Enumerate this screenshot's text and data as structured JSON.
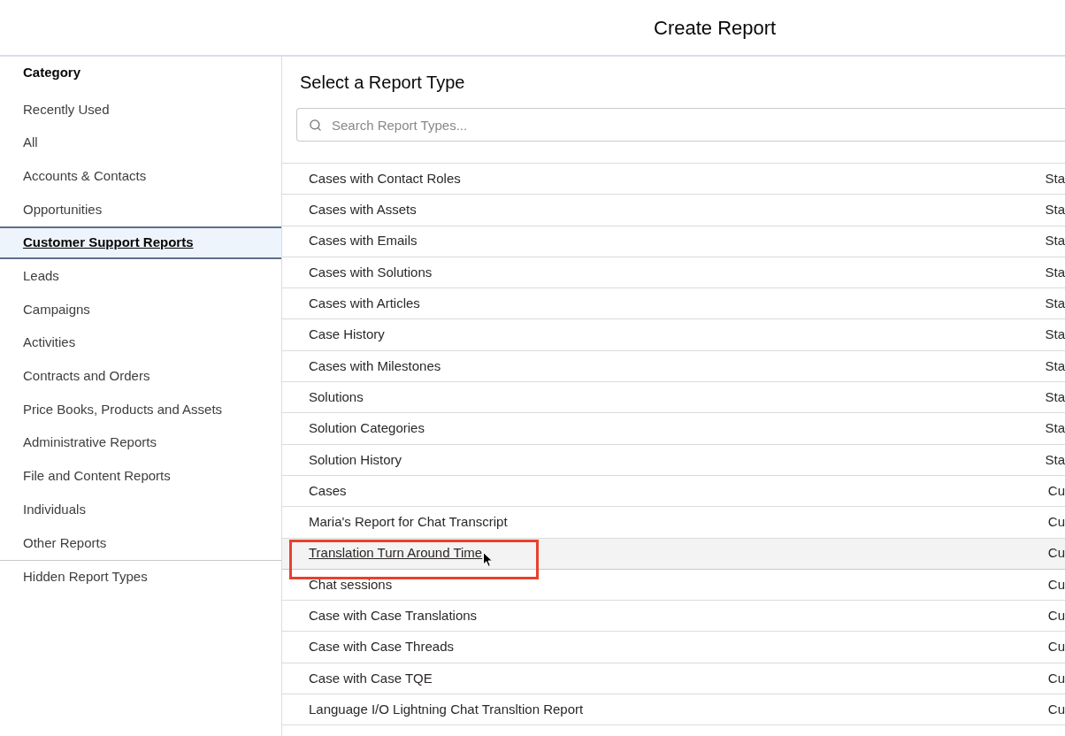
{
  "dialog": {
    "title": "Create Report"
  },
  "sidebar": {
    "heading": "Category",
    "items": [
      {
        "label": "Recently Used",
        "selected": false
      },
      {
        "label": "All",
        "selected": false
      },
      {
        "label": "Accounts & Contacts",
        "selected": false
      },
      {
        "label": "Opportunities",
        "selected": false
      },
      {
        "label": "Customer Support Reports",
        "selected": true
      },
      {
        "label": "Leads",
        "selected": false
      },
      {
        "label": "Campaigns",
        "selected": false
      },
      {
        "label": "Activities",
        "selected": false
      },
      {
        "label": "Contracts and Orders",
        "selected": false
      },
      {
        "label": "Price Books, Products and Assets",
        "selected": false
      },
      {
        "label": "Administrative Reports",
        "selected": false
      },
      {
        "label": "File and Content Reports",
        "selected": false
      },
      {
        "label": "Individuals",
        "selected": false
      },
      {
        "label": "Other Reports",
        "selected": false
      }
    ],
    "footer_items": [
      {
        "label": "Hidden Report Types",
        "selected": false
      }
    ]
  },
  "report_types": {
    "title": "Select a Report Type",
    "search": {
      "placeholder": "Search Report Types..."
    },
    "rows": [
      {
        "name": "Cases with Contact Roles",
        "column_2": "Sta",
        "hovered": false,
        "annotated": false
      },
      {
        "name": "Cases with Assets",
        "column_2": "Sta",
        "hovered": false,
        "annotated": false
      },
      {
        "name": "Cases with Emails",
        "column_2": "Sta",
        "hovered": false,
        "annotated": false
      },
      {
        "name": "Cases with Solutions",
        "column_2": "Sta",
        "hovered": false,
        "annotated": false
      },
      {
        "name": "Cases with Articles",
        "column_2": "Sta",
        "hovered": false,
        "annotated": false
      },
      {
        "name": "Case History",
        "column_2": "Sta",
        "hovered": false,
        "annotated": false
      },
      {
        "name": "Cases with Milestones",
        "column_2": "Sta",
        "hovered": false,
        "annotated": false
      },
      {
        "name": "Solutions",
        "column_2": "Sta",
        "hovered": false,
        "annotated": false
      },
      {
        "name": "Solution Categories",
        "column_2": "Sta",
        "hovered": false,
        "annotated": false
      },
      {
        "name": "Solution History",
        "column_2": "Sta",
        "hovered": false,
        "annotated": false
      },
      {
        "name": "Cases",
        "column_2": "Cu",
        "hovered": false,
        "annotated": false
      },
      {
        "name": "Maria's Report for Chat Transcript",
        "column_2": "Cu",
        "hovered": false,
        "annotated": false
      },
      {
        "name": "Translation Turn Around Time",
        "column_2": "Cu",
        "hovered": true,
        "annotated": true
      },
      {
        "name": "Chat sessions",
        "column_2": "Cu",
        "hovered": false,
        "annotated": false
      },
      {
        "name": "Case with Case Translations",
        "column_2": "Cu",
        "hovered": false,
        "annotated": false
      },
      {
        "name": "Case with Case Threads",
        "column_2": "Cu",
        "hovered": false,
        "annotated": false
      },
      {
        "name": "Case with Case TQE",
        "column_2": "Cu",
        "hovered": false,
        "annotated": false
      },
      {
        "name": "Language I/O Lightning Chat Transltion Report",
        "column_2": "Cu",
        "hovered": false,
        "annotated": false
      }
    ]
  }
}
